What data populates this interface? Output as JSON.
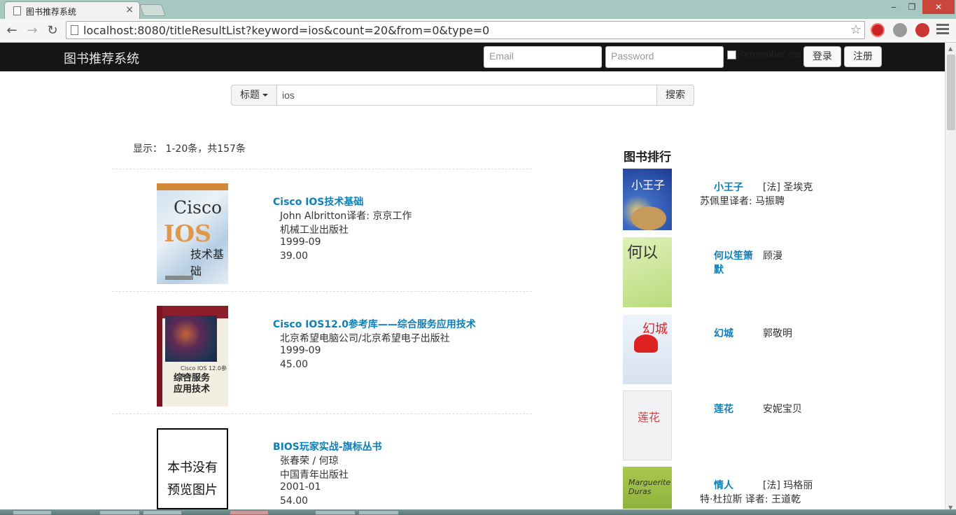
{
  "browser": {
    "tab_title": "图书推荐系统",
    "tab_close": "×",
    "url": "localhost:8080/titleResultList?keyword=ios&count=20&from=0&type=0",
    "window_controls": {
      "minimize": "‒",
      "maximize": "❐",
      "close": "✕"
    },
    "nav": {
      "back": "←",
      "forward": "→",
      "reload": "↻"
    },
    "star": "☆"
  },
  "navbar": {
    "brand": "图书推荐系统",
    "email_placeholder": "Email",
    "password_placeholder": "Password",
    "remember_label": "Remember me",
    "login_label": "登录",
    "register_label": "注册"
  },
  "search": {
    "type_label": "标题",
    "query": "ios",
    "button_label": "搜索"
  },
  "results": {
    "summary": "显示：  1-20条，共157条",
    "books": [
      {
        "title": "Cisco IOS技术基础",
        "lines": [
          "John Albritton译者: 京京工作",
          "机械工业出版社",
          "1999-09",
          "39.00"
        ],
        "cover_text": [
          "Cisco",
          "IOS",
          "技术基础"
        ]
      },
      {
        "title": "Cisco IOS12.0参考库——综合服务应用技术",
        "lines": [
          "北京希望电脑公司/北京希望电子出版社",
          "1999-09",
          "45.00"
        ],
        "cover_text": [
          "Cisco IOS 12.0参考库",
          "综合服务\n应用技术"
        ]
      },
      {
        "title": "BIOS玩家实战-旗标丛书",
        "lines": [
          "张春荣 / 何琼",
          "中国青年出版社",
          "2001-01",
          "54.00"
        ],
        "cover_text": [
          "本书没有",
          "预览图片"
        ]
      }
    ]
  },
  "ranking": {
    "title": "图书排行",
    "items": [
      {
        "name": "小王子",
        "author": "[法] 圣埃克",
        "author_cont": "苏佩里译者: 马振聘",
        "cover_text": "小王子"
      },
      {
        "name": "何以笙箫默",
        "name_line1": "何以笙箫",
        "name_line2": "默",
        "author": "顾漫",
        "cover_text": "何以"
      },
      {
        "name": "幻城",
        "author": "郭敬明",
        "cover_text": "幻城"
      },
      {
        "name": "莲花",
        "author": "安妮宝贝",
        "cover_text": "莲花"
      },
      {
        "name": "情人",
        "author": "[法] 玛格丽",
        "author_cont": "特·杜拉斯 译者: 王道乾",
        "cover_text": "Marguerite Duras"
      }
    ]
  },
  "colors": {
    "navbar_bg": "#151515",
    "link": "#0f7fb8",
    "tabstrip": "#a6c8c0",
    "close_button": "#c9463d"
  },
  "icons": [
    "page-icon",
    "back-icon",
    "forward-icon",
    "reload-icon",
    "star-icon",
    "menu-icon",
    "caret-down-icon"
  ]
}
